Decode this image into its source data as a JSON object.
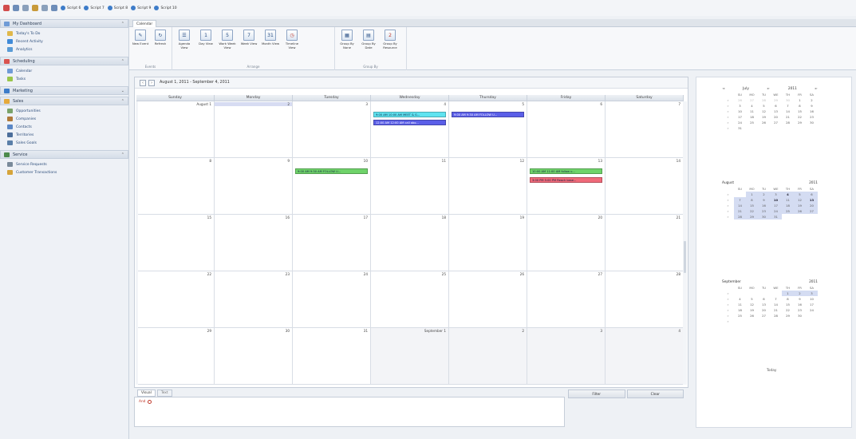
{
  "toolbar": {
    "scripts": [
      "Script 6",
      "Script 7",
      "Script 8",
      "Script 9",
      "Script 10"
    ]
  },
  "nav": {
    "dashboard": "My Dashboard",
    "dashboard_items": [
      "Today's To Do",
      "Recent Activity",
      "Analytics"
    ],
    "scheduling": "Scheduling",
    "scheduling_items": [
      "Calendar",
      "Tasks"
    ],
    "marketing": "Marketing",
    "sales": "Sales",
    "sales_items": [
      "Opportunities",
      "Companies",
      "Contacts",
      "Territories",
      "Sales Goals"
    ],
    "service": "Service",
    "service_items": [
      "Service Requests",
      "Customer Transactions"
    ]
  },
  "ribbon": {
    "tab": "Calendar",
    "events_group": "Events",
    "arrange_group": "Arrange",
    "group_by_group": "Group By",
    "buttons": {
      "new_event": "New Event",
      "refresh": "Refresh",
      "agenda": "Agenda View",
      "day": "Day View",
      "work_week": "Work Week View",
      "week": "Week View",
      "month": "Month View",
      "timeline": "Timeline View",
      "group_none": "Group By None",
      "group_date": "Group By Date",
      "group_resource": "Group By Resource"
    }
  },
  "calendar": {
    "range": "August 1, 2011 - September 4, 2011",
    "days": [
      "Sunday",
      "Monday",
      "Tuesday",
      "Wednesday",
      "Thursday",
      "Friday",
      "Saturday"
    ],
    "weeks": [
      [
        "August 1",
        "2",
        "3",
        "4",
        "5",
        "6",
        "7"
      ],
      [
        "8",
        "9",
        "10",
        "11",
        "12",
        "13",
        "14"
      ],
      [
        "15",
        "16",
        "17",
        "18",
        "19",
        "20",
        "21"
      ],
      [
        "22",
        "23",
        "24",
        "25",
        "26",
        "27",
        "28"
      ],
      [
        "29",
        "30",
        "31",
        "September 1",
        "2",
        "3",
        "4"
      ]
    ],
    "appointments": {
      "a1": "9:00 AM 10:00 AM MEET & G...",
      "a2": "12:00 AM 12:00 AM call abo...",
      "a3": "9:00 AM 9:30 AM FOLLOW U...",
      "a4": "9:00 AM 9:30 AM FOLLOW U...",
      "a5": "10:00 AM 11:00 AM follow u...",
      "a6": "3:00 PM 5:00 PM Reach base..."
    },
    "colors": {
      "cyan": "#5fe3f0",
      "blue": "#5b5fe8",
      "green": "#6fd36a",
      "red": "#f06a7a"
    }
  },
  "filter": {
    "tab_visual": "Visual",
    "tab_text": "Text",
    "operator": "And",
    "filter_btn": "Filter",
    "clear_btn": "Clear"
  },
  "mini_calendars": {
    "dow": [
      "SU",
      "MO",
      "TU",
      "WE",
      "TH",
      "FR",
      "SA"
    ],
    "july": {
      "month": "July",
      "year": "2011"
    },
    "august": {
      "month": "August",
      "year": "2011"
    },
    "september": {
      "month": "September",
      "year": "2011"
    },
    "today": "Today"
  }
}
